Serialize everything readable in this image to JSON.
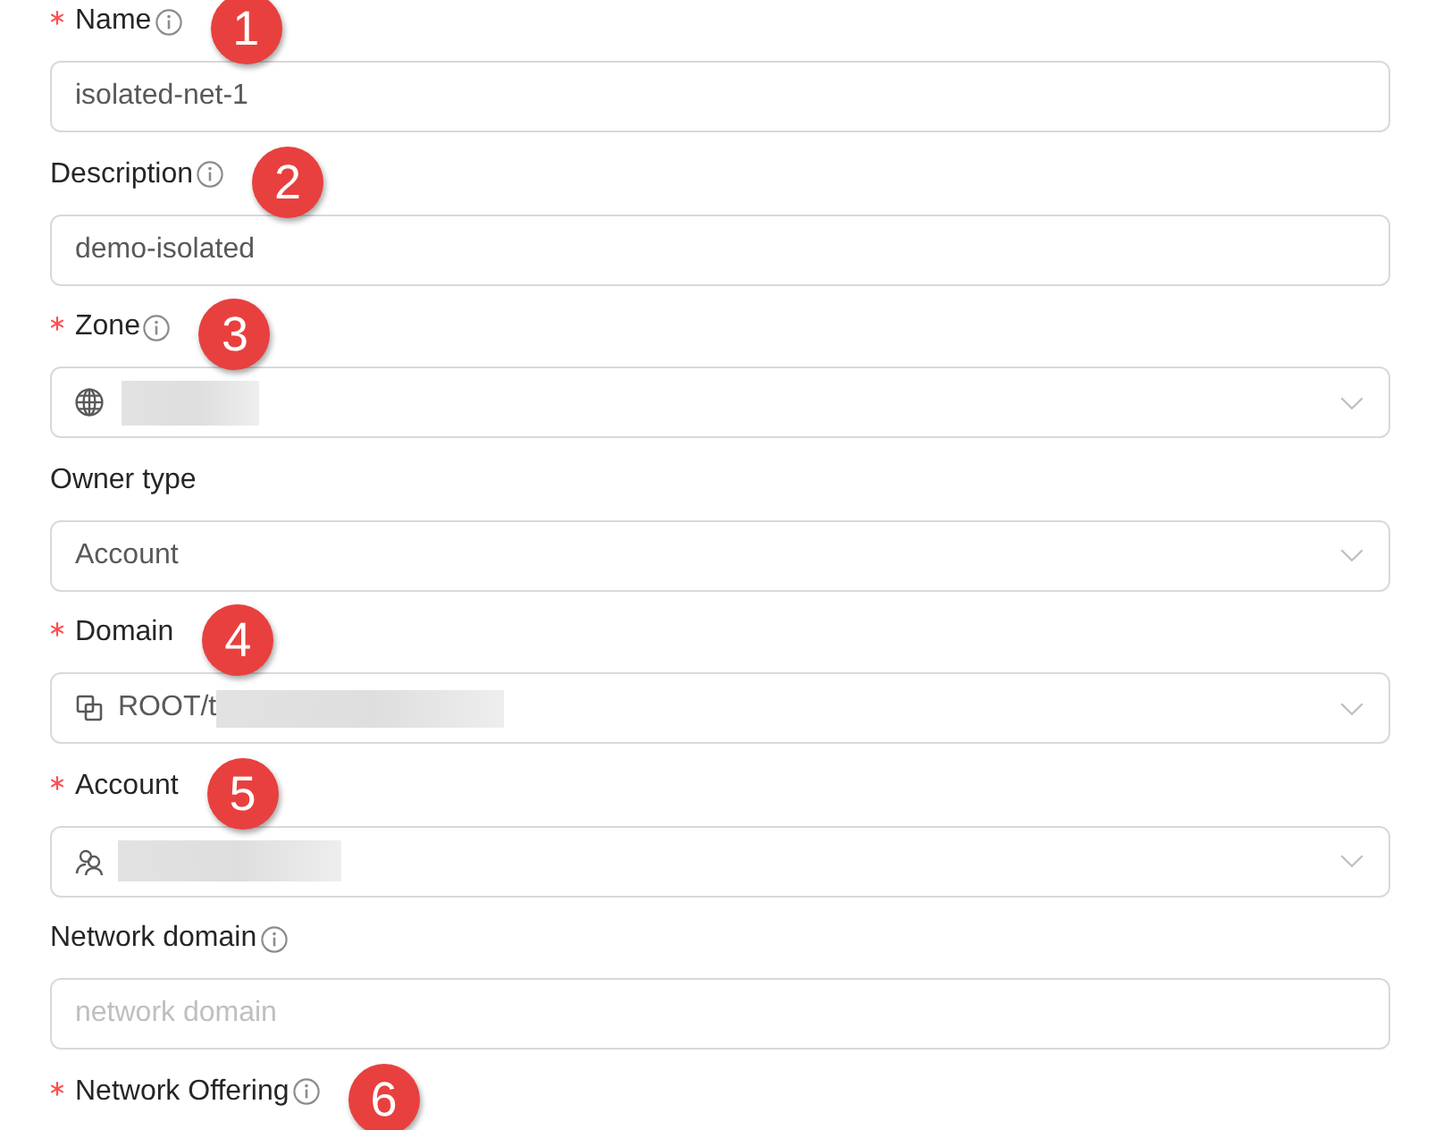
{
  "fields": [
    {
      "label": "Name",
      "required": true,
      "info": true,
      "callout": "1",
      "kind": "text",
      "value": "isolated-net-1"
    },
    {
      "label": "Description",
      "required": false,
      "info": true,
      "callout": "2",
      "kind": "text",
      "value": "demo-isolated"
    },
    {
      "label": "Zone",
      "required": true,
      "info": true,
      "callout": "3",
      "kind": "zone",
      "redacted": true
    },
    {
      "label": "Owner type",
      "required": false,
      "info": false,
      "kind": "select",
      "value": "Account"
    },
    {
      "label": "Domain",
      "required": true,
      "info": false,
      "callout": "4",
      "kind": "domain",
      "value": "ROOT/t",
      "redacted": true
    },
    {
      "label": "Account",
      "required": true,
      "info": false,
      "callout": "5",
      "kind": "account",
      "redacted": true
    },
    {
      "label": "Network domain",
      "required": false,
      "info": true,
      "kind": "text",
      "placeholder": "network domain"
    },
    {
      "label": "Network Offering",
      "required": true,
      "info": true,
      "callout": "6"
    }
  ]
}
